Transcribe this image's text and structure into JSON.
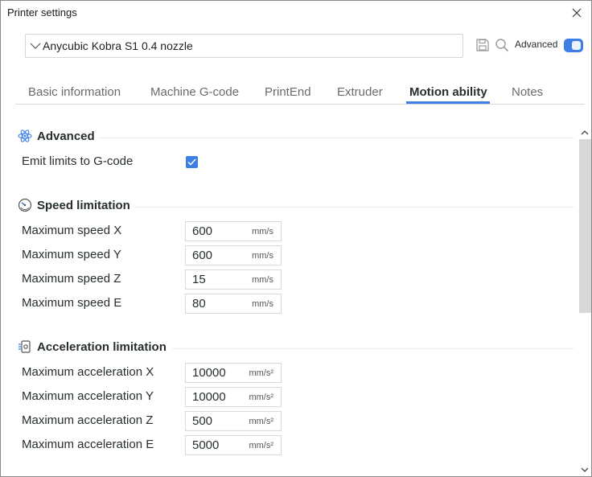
{
  "window": {
    "title": "Printer settings"
  },
  "preset": {
    "name": "Anycubic Kobra S1 0.4 nozzle"
  },
  "toolbar": {
    "advanced_label": "Advanced",
    "advanced_on": true
  },
  "tabs": [
    {
      "label": "Basic information",
      "active": false
    },
    {
      "label": "Machine G-code",
      "active": false
    },
    {
      "label": "PrintEnd",
      "active": false
    },
    {
      "label": "Extruder",
      "active": false
    },
    {
      "label": "Motion ability",
      "active": true
    },
    {
      "label": "Notes",
      "active": false
    }
  ],
  "sections": {
    "advanced": {
      "title": "Advanced",
      "emit_limits": {
        "label": "Emit limits to G-code",
        "checked": true
      }
    },
    "speed": {
      "title": "Speed limitation",
      "rows": [
        {
          "label": "Maximum speed X",
          "value": "600",
          "unit": "mm/s"
        },
        {
          "label": "Maximum speed Y",
          "value": "600",
          "unit": "mm/s"
        },
        {
          "label": "Maximum speed Z",
          "value": "15",
          "unit": "mm/s"
        },
        {
          "label": "Maximum speed E",
          "value": "80",
          "unit": "mm/s"
        }
      ]
    },
    "acceleration": {
      "title": "Acceleration limitation",
      "rows": [
        {
          "label": "Maximum acceleration X",
          "value": "10000",
          "unit": "mm/s²"
        },
        {
          "label": "Maximum acceleration Y",
          "value": "10000",
          "unit": "mm/s²"
        },
        {
          "label": "Maximum acceleration Z",
          "value": "500",
          "unit": "mm/s²"
        },
        {
          "label": "Maximum acceleration E",
          "value": "5000",
          "unit": "mm/s²"
        }
      ]
    }
  },
  "colors": {
    "accent": "#3e7fe6",
    "text": "#262e30",
    "muted_tab": "#6b6b6b"
  }
}
